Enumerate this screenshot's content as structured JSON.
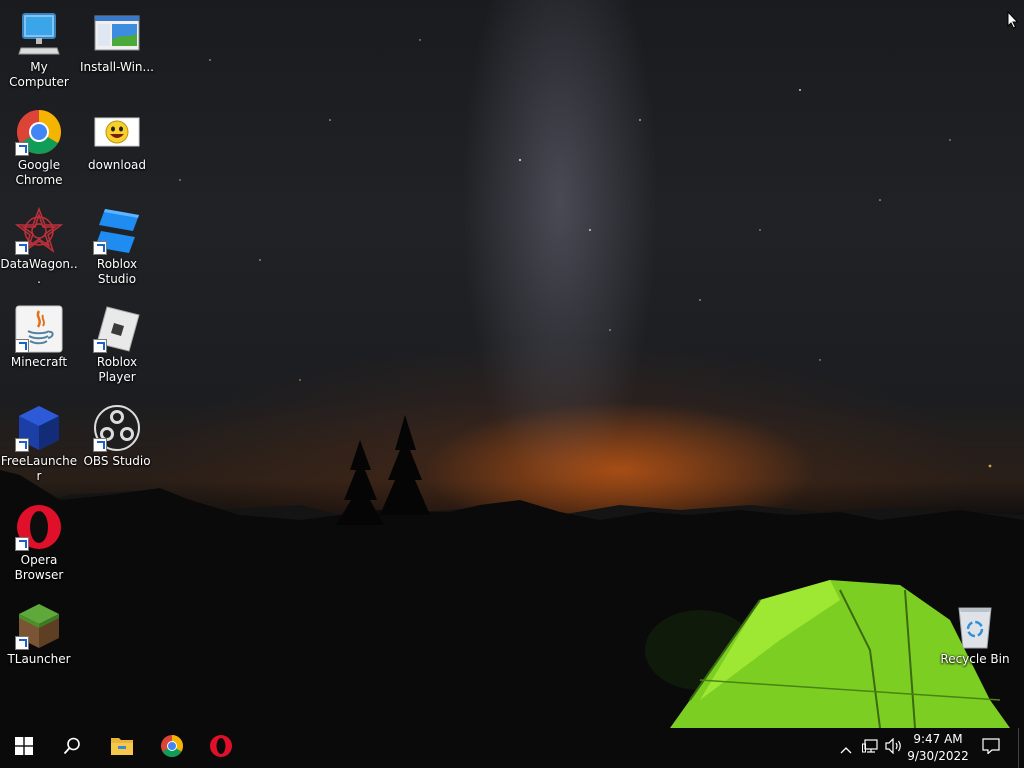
{
  "desktop": {
    "icons": [
      {
        "name": "my-computer",
        "label": "My Computer"
      },
      {
        "name": "install-windows",
        "label": "Install-Win..."
      },
      {
        "name": "google-chrome",
        "label": "Google Chrome"
      },
      {
        "name": "download",
        "label": "download"
      },
      {
        "name": "datawagon",
        "label": "DataWagon..."
      },
      {
        "name": "roblox-studio",
        "label": "Roblox Studio"
      },
      {
        "name": "minecraft",
        "label": "Minecraft"
      },
      {
        "name": "roblox-player",
        "label": "Roblox Player"
      },
      {
        "name": "freelauncher",
        "label": "FreeLauncher"
      },
      {
        "name": "obs-studio",
        "label": "OBS Studio"
      },
      {
        "name": "opera-browser",
        "label": "Opera Browser"
      },
      {
        "name": "tlauncher",
        "label": "TLauncher"
      },
      {
        "name": "recycle-bin",
        "label": "Recycle Bin"
      }
    ]
  },
  "taskbar": {
    "pinned": [
      "windows-start-icon",
      "search-icon",
      "file-explorer-icon",
      "chrome-icon",
      "opera-icon"
    ],
    "tray_icons": [
      "chevron-up-icon",
      "network-icon",
      "volume-icon"
    ],
    "clock": {
      "time": "9:47 AM",
      "date": "9/30/2022"
    },
    "notification_icon": "action-center-icon"
  },
  "colors": {
    "taskbar_bg": "#0a0a0a",
    "windows_blue": "#2f8fd8",
    "tent_green": "#8fdc2a",
    "sunset_orange": "#d0651c"
  }
}
